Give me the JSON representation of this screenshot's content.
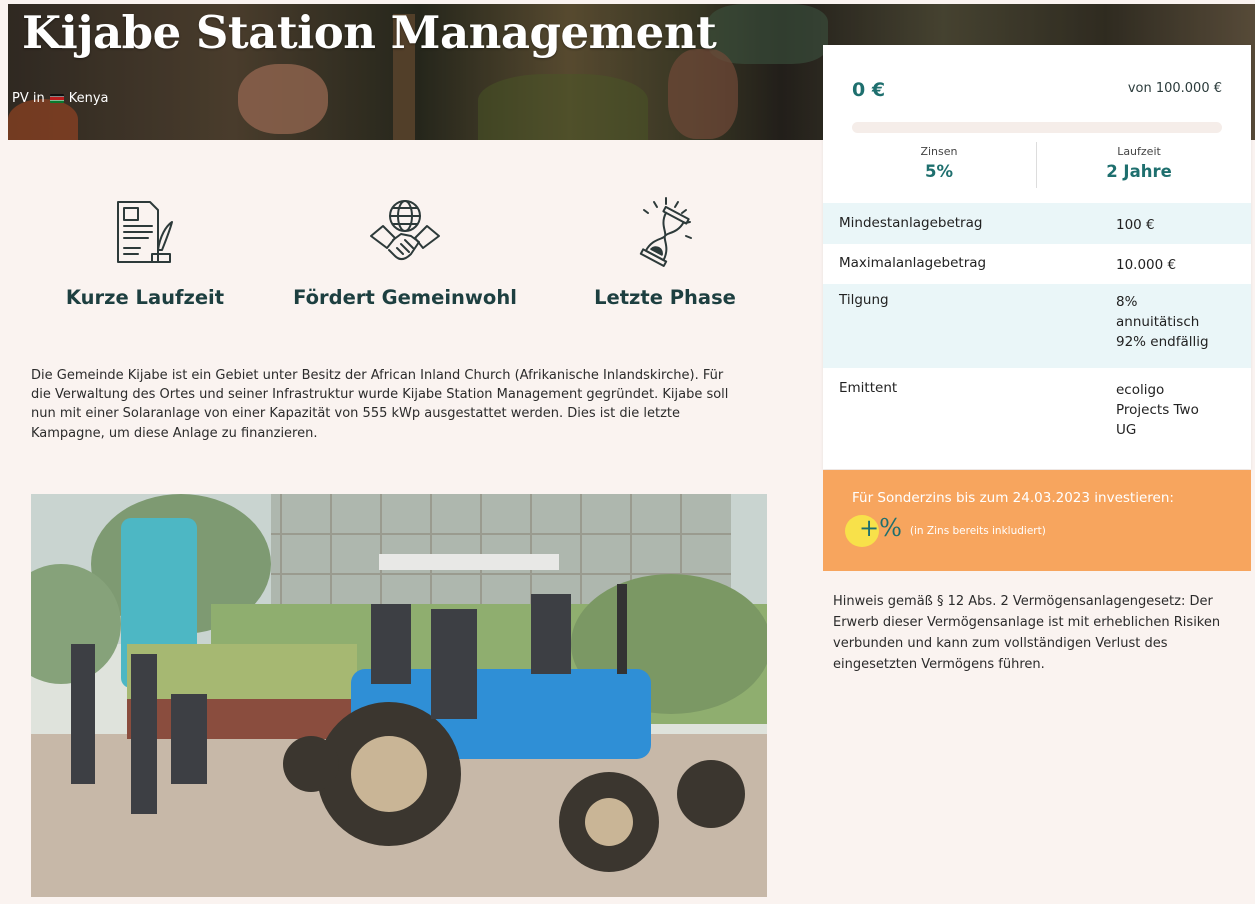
{
  "hero": {
    "title": "Kijabe Station Management",
    "subtitle_prefix": "PV in",
    "country": "Kenya"
  },
  "features": [
    {
      "label": "Kurze Laufzeit",
      "icon": "contract-icon"
    },
    {
      "label": "Fördert Gemeinwohl",
      "icon": "handshake-globe-icon"
    },
    {
      "label": "Letzte Phase",
      "icon": "hourglass-icon"
    }
  ],
  "description": "Die Gemeinde Kijabe ist ein Gebiet unter Besitz der African Inland Church (Afrikanische Inlandskirche). Für die Verwaltung des Ortes und seiner Infrastruktur wurde Kijabe Station Management gegründet. Kijabe soll nun mit einer Solaranlage von einer Kapazität von 555 kWp ausgestattet werden. Dies ist die letzte Kampagne, um diese Anlage zu finanzieren.",
  "panel": {
    "amount": "0 €",
    "goal": "von 100.000 €",
    "progress_fraction": 0,
    "zinsen_label": "Zinsen",
    "zinsen_value": "5%",
    "laufzeit_label": "Laufzeit",
    "laufzeit_value": "2 Jahre",
    "rows": [
      {
        "key": "Mindestanlagebetrag",
        "lines": [
          "100 €"
        ]
      },
      {
        "key": "Maximalanlagebetrag",
        "lines": [
          "10.000 €"
        ]
      },
      {
        "key": "Tilgung",
        "lines": [
          "8%",
          "annuitätisch",
          "92% endfällig"
        ]
      },
      {
        "key": "Emittent",
        "lines": [
          "ecoligo",
          "Projects Two",
          "UG"
        ]
      }
    ]
  },
  "promo": {
    "text": "Für Sonderzins bis zum 24.03.2023 investieren:",
    "plus": "+%",
    "note": "(in Zins bereits inkludiert)"
  },
  "legal": "Hinweis gemäß § 12 Abs. 2 Vermögensanlagengesetz: Der Erwerb dieser Vermögensanlage ist mit erheblichen Risiken verbunden und kann zum vollständigen Verlust des eingesetzten Vermögens führen.",
  "colors": {
    "brand_teal": "#1e6f6e",
    "promo_orange": "#f7a55e",
    "page_bg": "#faf3f0",
    "row_alt": "#eaf6f8"
  }
}
